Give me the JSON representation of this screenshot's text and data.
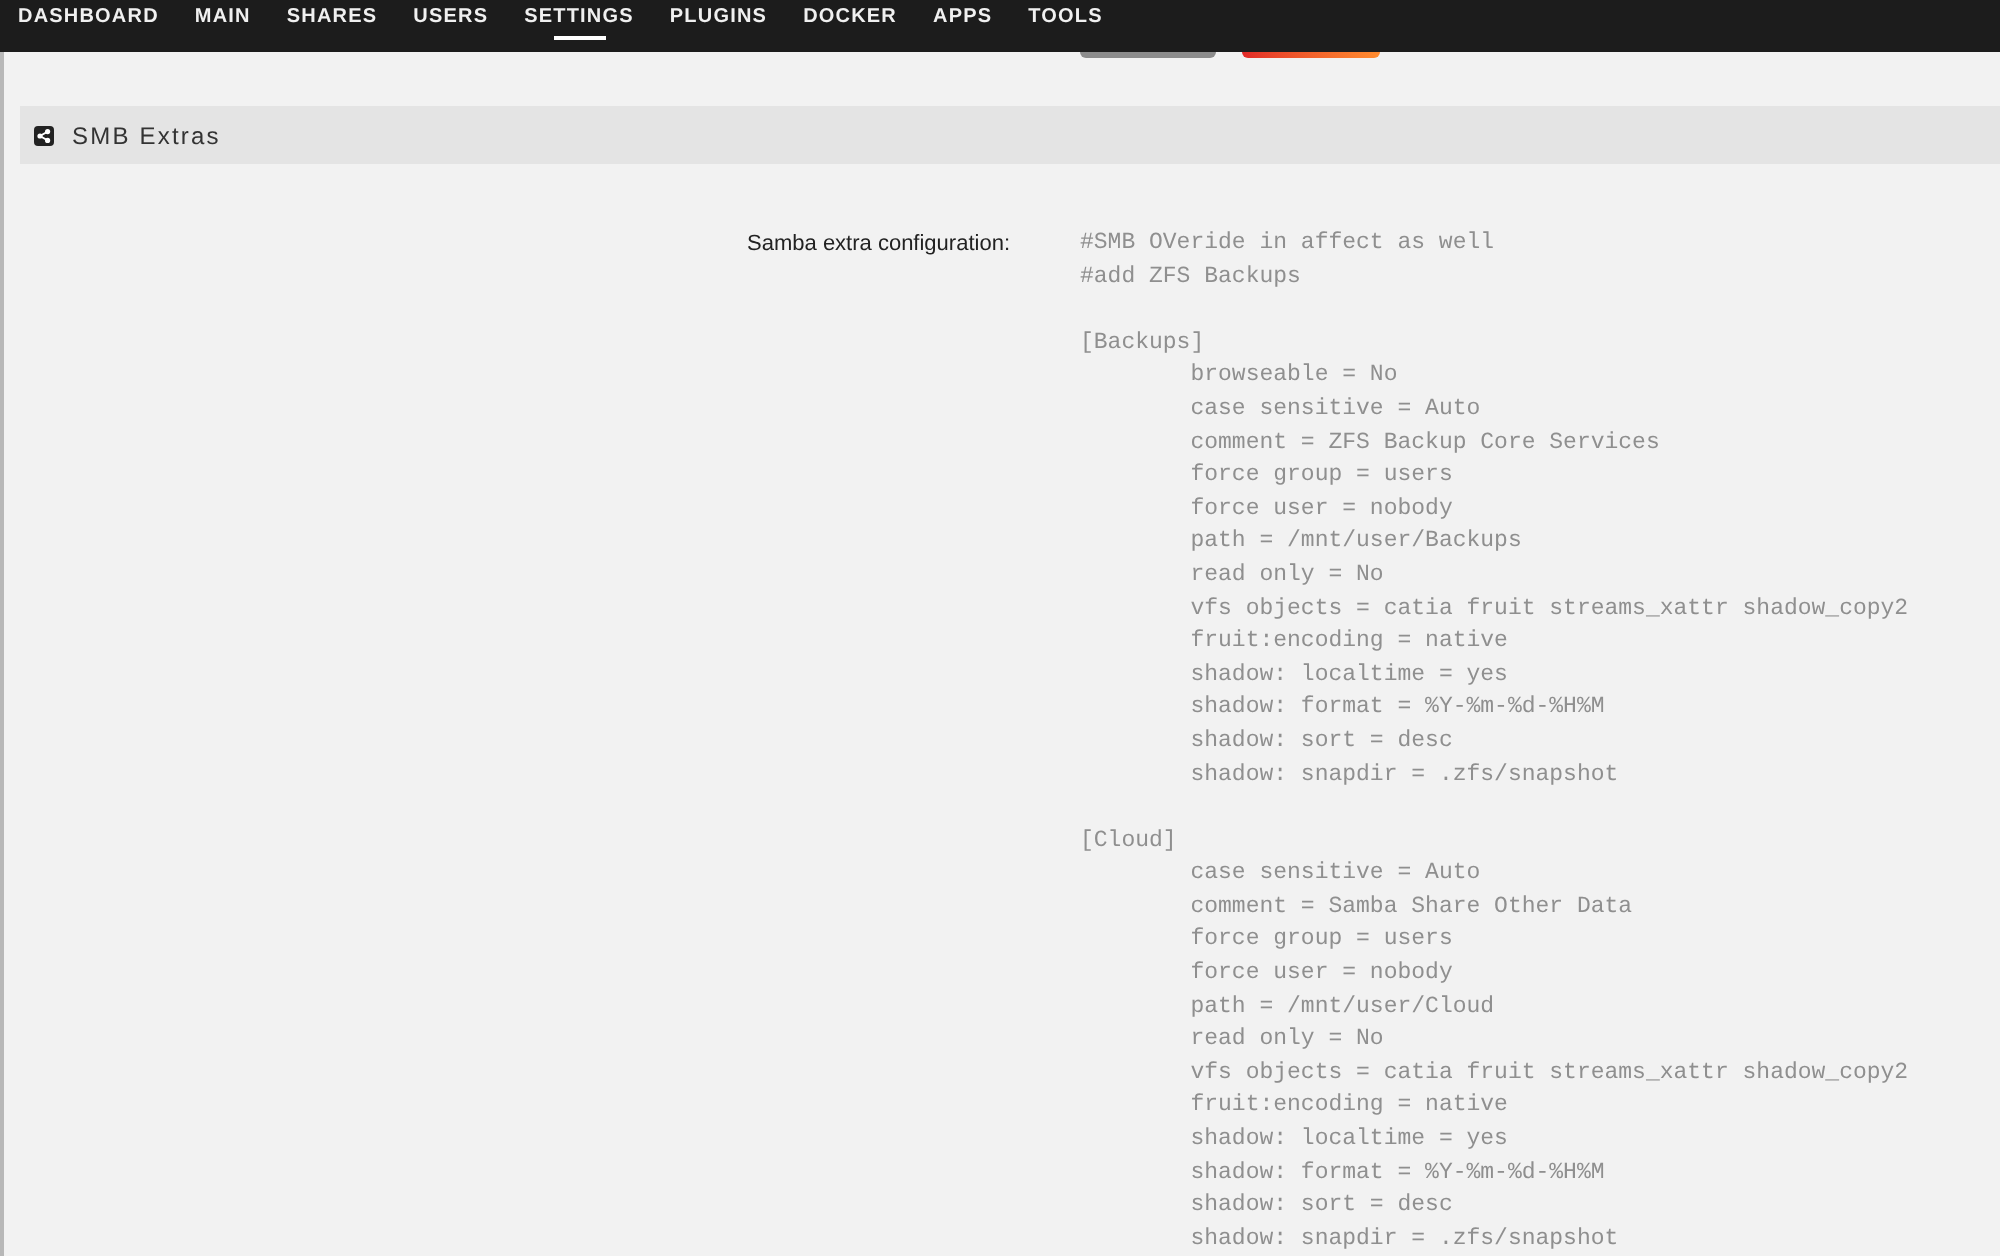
{
  "nav": {
    "items": [
      {
        "label": "DASHBOARD",
        "selected": false
      },
      {
        "label": "MAIN",
        "selected": false
      },
      {
        "label": "SHARES",
        "selected": false
      },
      {
        "label": "USERS",
        "selected": false
      },
      {
        "label": "SETTINGS",
        "selected": true
      },
      {
        "label": "PLUGINS",
        "selected": false
      },
      {
        "label": "DOCKER",
        "selected": false
      },
      {
        "label": "APPS",
        "selected": false
      },
      {
        "label": "TOOLS",
        "selected": false
      }
    ]
  },
  "section": {
    "title": "SMB Extras"
  },
  "settings": [
    {
      "label": "Samba extra configuration:",
      "value": "#SMB OVeride in affect as well\n#add ZFS Backups\n\n[Backups]\n\tbrowseable = No\n\tcase sensitive = Auto\n\tcomment = ZFS Backup Core Services\n\tforce group = users\n\tforce user = nobody\n\tpath = /mnt/user/Backups\n\tread only = No\n\tvfs objects = catia fruit streams_xattr shadow_copy2\n\tfruit:encoding = native\n\tshadow: localtime = yes\n\tshadow: format = %Y-%m-%d-%H%M\n\tshadow: sort = desc\n\tshadow: snapdir = .zfs/snapshot\n\n[Cloud]\n\tcase sensitive = Auto\n\tcomment = Samba Share Other Data\n\tforce group = users\n\tforce user = nobody\n\tpath = /mnt/user/Cloud\n\tread only = No\n\tvfs objects = catia fruit streams_xattr shadow_copy2\n\tfruit:encoding = native\n\tshadow: localtime = yes\n\tshadow: format = %Y-%m-%d-%H%M\n\tshadow: sort = desc\n\tshadow: snapdir = .zfs/snapshot"
    }
  ]
}
